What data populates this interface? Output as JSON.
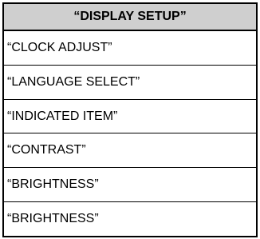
{
  "menu": {
    "title": "“DISPLAY SETUP”",
    "items": [
      {
        "label": "“CLOCK ADJUST”"
      },
      {
        "label": "“LANGUAGE SELECT”"
      },
      {
        "label": "“INDICATED ITEM”"
      },
      {
        "label": "“CONTRAST”"
      },
      {
        "label": "“BRIGHTNESS”"
      },
      {
        "label": "“BRIGHTNESS”"
      }
    ]
  },
  "colors": {
    "header_background": "#cfcfcf",
    "border": "#000000",
    "text": "#000000"
  }
}
